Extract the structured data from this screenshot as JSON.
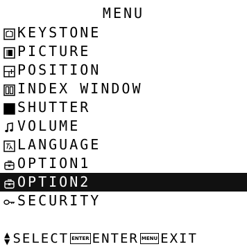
{
  "menu": {
    "title": "MENU",
    "selected_index": 9,
    "items": [
      {
        "label": "KEYSTONE",
        "icon": "keystone-icon"
      },
      {
        "label": "PICTURE",
        "icon": "picture-icon"
      },
      {
        "label": "POSITION",
        "icon": "position-icon"
      },
      {
        "label": "INDEX WINDOW",
        "icon": "index-window-icon"
      },
      {
        "label": "SHUTTER",
        "icon": "shutter-icon"
      },
      {
        "label": "VOLUME",
        "icon": "volume-icon"
      },
      {
        "label": "LANGUAGE",
        "icon": "language-icon"
      },
      {
        "label": "OPTION1",
        "icon": "option-icon"
      },
      {
        "label": "OPTION2",
        "icon": "option-icon"
      },
      {
        "label": "SECURITY",
        "icon": "key-icon"
      }
    ]
  },
  "footer": {
    "select_label": "SELECT",
    "enter_key": "ENTER",
    "enter_label": "ENTER",
    "menu_key": "MENU",
    "exit_label": "EXIT"
  },
  "colors": {
    "background": "#ffffff",
    "text": "#000000",
    "highlight": "#111111",
    "highlight_text": "#ffffff"
  }
}
